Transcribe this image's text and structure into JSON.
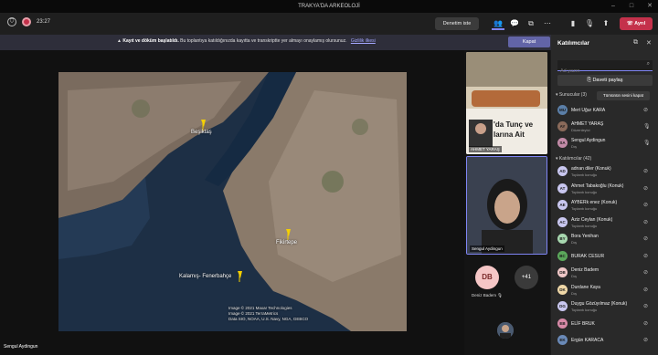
{
  "window": {
    "title": "TRAKYA'DA ARKEOLOJİ"
  },
  "toolbar": {
    "timer": "23:27",
    "control_label": "Denetim iste",
    "leave_label": "Ayrıl"
  },
  "banner": {
    "bold": "Kayıt ve döküm başlatıldı.",
    "text": "Bu toplantıya katıldığınızda kayıtta ve transkriptte yer almayı onaylamış olursunuz.",
    "link": "Gizlilik ilkesi",
    "close_label": "Kapat"
  },
  "stage": {
    "presenter_name": "Sengul Aydingun",
    "map_labels": [
      "Beşiktaş",
      "Fikirtepe",
      "Kalamış- Fenerbahçe"
    ],
    "map_attribution": [
      "Image © 2021 Maxar Technologies",
      "Image © 2021 TerraMetrics",
      "Data SIO, NOAA, U.S. Navy, NGA, GEBCO"
    ]
  },
  "side": {
    "thumb1_name": "AHMET YARAŞ",
    "thumb1_overlay": [
      "'da Tunç ve",
      "larına Ait"
    ],
    "thumb2_name": "Sengul Aydingun",
    "avatar_initials": "DB",
    "avatar_name": "Deniz Badem",
    "more_count": "+41"
  },
  "panel": {
    "title": "Katılımcılar",
    "search_placeholder": "Ad yazın",
    "share_label": "Daveti paylaş",
    "presenters_heading": "Sunucular (3)",
    "mute_all_label": "Tümünün sesini kapat",
    "attendees_heading": "Katılımcılar (42)",
    "presenters": [
      {
        "initials": "MU",
        "name": "Mert Uğur KARA",
        "role": "",
        "color": "#5b7fa8"
      },
      {
        "initials": "AY",
        "name": "AHMET YARAŞ",
        "role": "Düzenleyici",
        "color": "#8a6a5a"
      },
      {
        "initials": "SA",
        "name": "Sengul Aydingun",
        "role": "Dış",
        "color": "#c38ba8"
      }
    ],
    "attendees": [
      {
        "initials": "AD",
        "name": "adnan diler (Konuk)",
        "role": "Toplantı konuğu",
        "color": "#c9c7f0"
      },
      {
        "initials": "AT",
        "name": "Ahmet Tabakoğlu (Konuk)",
        "role": "Toplantı konuğu",
        "color": "#c9c7f0"
      },
      {
        "initials": "AE",
        "name": "AYBERk enez (Konuk)",
        "role": "Toplantı konuğu",
        "color": "#c9c7f0"
      },
      {
        "initials": "AC",
        "name": "Aziz Ceylan (Konuk)",
        "role": "Toplantı konuğu",
        "color": "#c9c7f0"
      },
      {
        "initials": "BY",
        "name": "Bora Yenihan",
        "role": "Dış",
        "color": "#a8d8b0"
      },
      {
        "initials": "BC",
        "name": "BURAK CESUR",
        "role": "",
        "color": "#5ba85b"
      },
      {
        "initials": "DB",
        "name": "Deniz Badem",
        "role": "Dış",
        "color": "#f0c8c8"
      },
      {
        "initials": "DK",
        "name": "Durdane Kaya",
        "role": "Dış",
        "color": "#f0d8a8"
      },
      {
        "initials": "DG",
        "name": "Duygu Gözüyılmaz (Konuk)",
        "role": "Toplantı konuğu",
        "color": "#c9c7f0"
      },
      {
        "initials": "EB",
        "name": "ELİF BRUK",
        "role": "",
        "color": "#d88aa8"
      },
      {
        "initials": "EK",
        "name": "Ergün KARACA",
        "role": "",
        "color": "#6a8ab8"
      }
    ]
  }
}
